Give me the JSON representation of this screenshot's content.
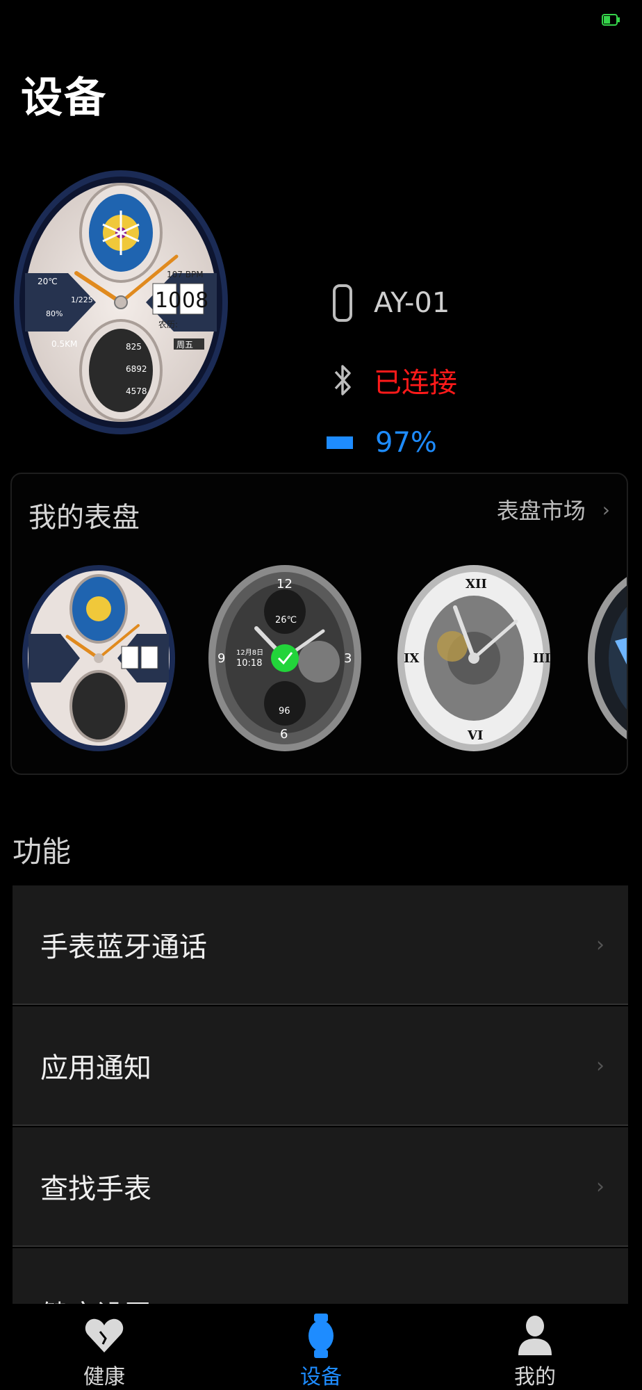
{
  "header": {
    "title": "设备"
  },
  "device": {
    "name": "AY-01",
    "status": "已连接",
    "battery": "97%",
    "face_texts": {
      "temp": "20℃",
      "date": "1/225",
      "percent": "80%",
      "distance": "0.5KM",
      "bpm": "107 BPM",
      "hour": "10",
      "minute": "08",
      "lunar": "农历:",
      "weekday": "周五",
      "steps1": "825",
      "steps2": "6892",
      "kcal": "4578"
    }
  },
  "faces": {
    "title": "我的表盘",
    "market": "表盘市场",
    "face2": {
      "n12": "12",
      "n3": "3",
      "n6": "6",
      "n9": "9",
      "temp": "26℃",
      "date": "12月8日",
      "time": "10:18",
      "hr": "96"
    }
  },
  "functions": {
    "title": "功能",
    "items": [
      {
        "label": "手表蓝牙通话"
      },
      {
        "label": "应用通知"
      },
      {
        "label": "查找手表"
      },
      {
        "label": "健康设置"
      }
    ]
  },
  "nav": {
    "items": [
      {
        "label": "健康"
      },
      {
        "label": "设备"
      },
      {
        "label": "我的"
      }
    ]
  },
  "colors": {
    "accent": "#1e8cff",
    "connected": "#ff1a1a",
    "battery_bar": "#1e8cff",
    "status_battery": "#35d34a"
  },
  "icons": {
    "device": "watch-outline-icon",
    "bluetooth": "bluetooth-icon",
    "battery": "battery-icon",
    "nav_health": "heart-icon",
    "nav_device": "watch-icon",
    "nav_me": "person-icon"
  }
}
